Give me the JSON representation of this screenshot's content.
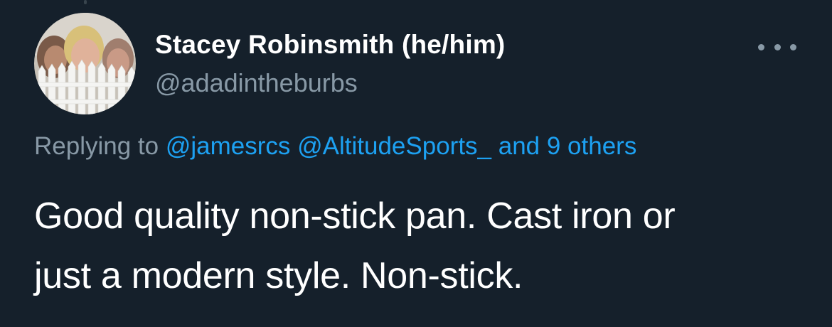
{
  "tweet": {
    "author": {
      "display_name": "Stacey Robinsmith (he/him)",
      "handle": "@adadintheburbs"
    },
    "more_icon": "ellipsis-icon",
    "reply_context": {
      "prefix": "Replying to",
      "mentions": [
        "@jamesrcs",
        "@AltitudeSports_"
      ],
      "others": "and 9 others"
    },
    "text_lines": [
      "Good quality non-stick pan. Cast iron or",
      "just a modern style. Non-stick."
    ]
  },
  "colors": {
    "background": "#15202b",
    "primary_text": "#ffffff",
    "secondary_text": "#8899a6",
    "link": "#1da1f2"
  }
}
